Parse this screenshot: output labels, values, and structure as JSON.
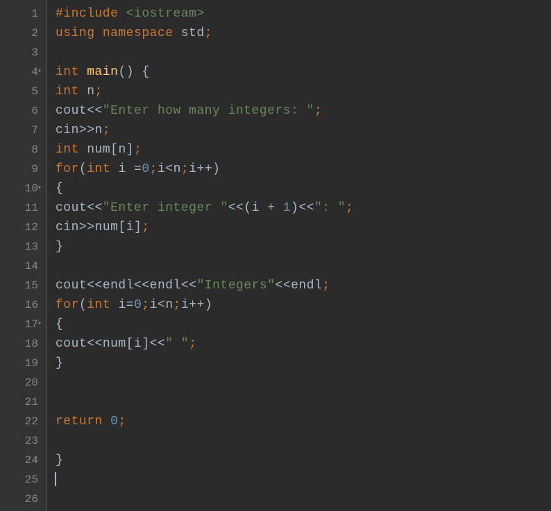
{
  "gutter": {
    "numbers": [
      "1",
      "2",
      "3",
      "4",
      "5",
      "6",
      "7",
      "8",
      "9",
      "10",
      "11",
      "12",
      "13",
      "14",
      "15",
      "16",
      "17",
      "18",
      "19",
      "20",
      "21",
      "22",
      "23",
      "24",
      "25",
      "26"
    ],
    "foldLines": [
      4,
      10,
      17
    ]
  },
  "code": {
    "l1": {
      "a": "#include ",
      "b": "<iostream>"
    },
    "l2": {
      "a": "using ",
      "b": "namespace ",
      "c": "std",
      "d": ";"
    },
    "l4": {
      "a": "int ",
      "b": "main",
      "c": "() ",
      "d": "{"
    },
    "l5": {
      "a": "int ",
      "b": "n",
      "c": ";"
    },
    "l6": {
      "a": "cout",
      "b": "<<",
      "c": "\"Enter how many integers: \"",
      "d": ";"
    },
    "l7": {
      "a": "cin",
      "b": ">>",
      "c": "n",
      "d": ";"
    },
    "l8": {
      "a": "int ",
      "b": "num",
      "c": "[",
      "d": "n",
      "e": "]",
      "f": ";"
    },
    "l9": {
      "a": "for",
      "b": "(",
      "c": "int ",
      "d": "i ",
      "e": "=",
      "f": "0",
      "g": ";",
      "h": "i",
      "i": "<",
      "j": "n",
      "k": ";",
      "l": "i",
      "m": "++)"
    },
    "l10": {
      "a": "{"
    },
    "l11": {
      "a": "cout",
      "b": "<<",
      "c": "\"Enter integer \"",
      "d": "<<(",
      "e": "i ",
      "f": "+ ",
      "g": "1",
      "h": ")<<",
      "i": "\": \"",
      "j": ";"
    },
    "l12": {
      "a": "cin",
      "b": ">>",
      "c": "num",
      "d": "[",
      "e": "i",
      "f": "]",
      "g": ";"
    },
    "l13": {
      "a": "}"
    },
    "l15": {
      "a": "cout",
      "b": "<<",
      "c": "endl",
      "d": "<<",
      "e": "endl",
      "f": "<<",
      "g": "\"Integers\"",
      "h": "<<",
      "i": "endl",
      "j": ";"
    },
    "l16": {
      "a": "for",
      "b": "(",
      "c": "int ",
      "d": "i",
      "e": "=",
      "f": "0",
      "g": ";",
      "h": "i",
      "i": "<",
      "j": "n",
      "k": ";",
      "l": "i",
      "m": "++)"
    },
    "l17": {
      "a": "{"
    },
    "l18": {
      "a": "cout",
      "b": "<<",
      "c": "num",
      "d": "[",
      "e": "i",
      "f": "]",
      "g": "<<",
      "h": "\" \"",
      "i": ";"
    },
    "l19": {
      "a": "}"
    },
    "l22": {
      "a": "return ",
      "b": "0",
      "c": ";"
    },
    "l24": {
      "a": "}"
    }
  }
}
